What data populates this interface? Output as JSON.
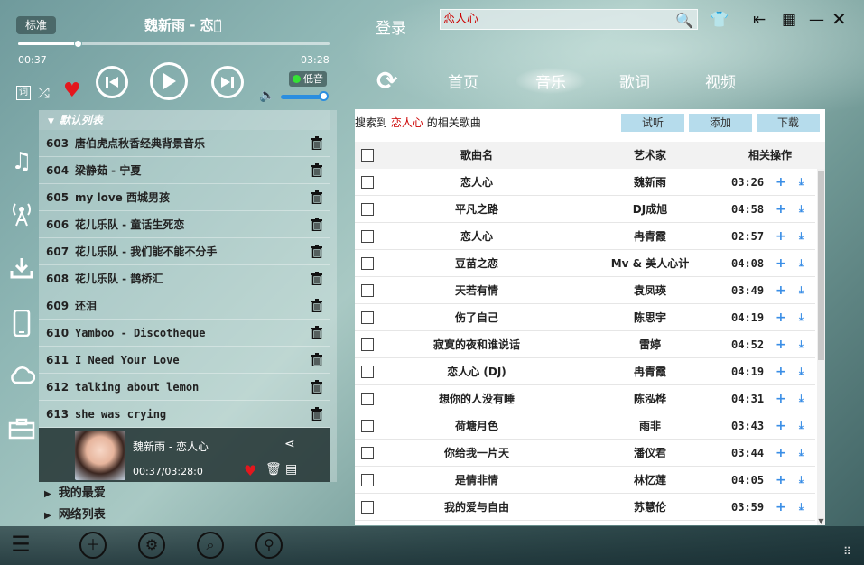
{
  "player": {
    "mode_badge": "标准",
    "now_title": "魏新雨 - 恋人̃",
    "time_current": "00:37",
    "time_total": "03:28",
    "progress": 0.19,
    "lyric_btn": "词",
    "quality": "低音",
    "volume": 0.9
  },
  "header": {
    "login": "登录",
    "search_value": "恋人心"
  },
  "nav_tabs": [
    {
      "label": "首页"
    },
    {
      "label": "音乐"
    },
    {
      "label": "歌词"
    },
    {
      "label": "视频"
    }
  ],
  "playlist": {
    "header": "默认列表",
    "items": [
      {
        "num": "603",
        "title": "唐伯虎点秋香经典背景音乐"
      },
      {
        "num": "604",
        "title": "梁静茹 - 宁夏"
      },
      {
        "num": "605",
        "title": "my love 西城男孩"
      },
      {
        "num": "606",
        "title": "花儿乐队 - 童话生死恋"
      },
      {
        "num": "607",
        "title": "花儿乐队 - 我们能不能不分手"
      },
      {
        "num": "608",
        "title": "花儿乐队 - 鹊桥汇"
      },
      {
        "num": "609",
        "title": "还泪"
      },
      {
        "num": "610",
        "title": "Yamboo - Discotheque"
      },
      {
        "num": "611",
        "title": "I Need Your Love"
      },
      {
        "num": "612",
        "title": "talking about lemon"
      },
      {
        "num": "613",
        "title": "she was crying"
      }
    ],
    "now_card": {
      "name": "魏新雨 - 恋人心",
      "time": "00:37/03:28:0"
    },
    "groups": [
      {
        "label": "我的最爱"
      },
      {
        "label": "网络列表"
      }
    ]
  },
  "results": {
    "prefix": "搜索到",
    "keyword": "恋人心",
    "suffix": "的相关歌曲",
    "buttons": {
      "listen": "试听",
      "add": "添加",
      "download": "下载"
    },
    "columns": {
      "name": "歌曲名",
      "artist": "艺术家",
      "ops": "相关操作"
    },
    "rows": [
      {
        "name": "恋人心",
        "artist": "魏新雨",
        "dur": "03:26"
      },
      {
        "name": "平凡之路",
        "artist": "DJ成旭",
        "dur": "04:58"
      },
      {
        "name": "恋人心",
        "artist": "冉青霞",
        "dur": "02:57"
      },
      {
        "name": "豆苗之恋",
        "artist": "Mv & 美人心计",
        "dur": "04:08"
      },
      {
        "name": "天若有情",
        "artist": "袁凤瑛",
        "dur": "03:49"
      },
      {
        "name": "伤了自己",
        "artist": "陈思宇",
        "dur": "04:19"
      },
      {
        "name": "寂寞的夜和谁说话",
        "artist": "雷婷",
        "dur": "04:52"
      },
      {
        "name": "恋人心 (DJ)",
        "artist": "冉青霞",
        "dur": "04:19"
      },
      {
        "name": "想你的人没有睡",
        "artist": "陈泓桦",
        "dur": "04:31"
      },
      {
        "name": "荷塘月色",
        "artist": "雨非",
        "dur": "03:43"
      },
      {
        "name": "你给我一片天",
        "artist": "潘仪君",
        "dur": "03:44"
      },
      {
        "name": "是情非情",
        "artist": "林忆莲",
        "dur": "04:05"
      },
      {
        "name": "我的爱与自由",
        "artist": "苏慧伦",
        "dur": "03:59"
      }
    ]
  },
  "colors": {
    "accent": "#3a8ee6",
    "heart": "#e4171d",
    "keyword": "#cc0000",
    "button": "#b6dcec"
  }
}
